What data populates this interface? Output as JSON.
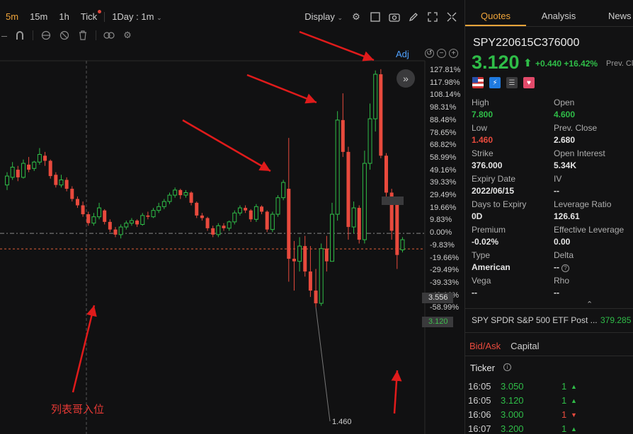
{
  "toolbar": {
    "intervals": [
      "5m",
      "15m",
      "1h",
      "Tick"
    ],
    "active_interval": "5m",
    "range_select": "1Day : 1m",
    "display_label": "Display"
  },
  "chart": {
    "adj_label": "Adj",
    "y_ticks": [
      "127.81%",
      "117.98%",
      "108.14%",
      "98.31%",
      "88.48%",
      "78.65%",
      "68.82%",
      "58.99%",
      "49.16%",
      "39.33%",
      "29.49%",
      "19.66%",
      "9.83%",
      "0.00%",
      "-9.83%",
      "-19.66%",
      "-29.49%",
      "-39.33%",
      "-49.16%",
      "-58.99%"
    ],
    "ref_price_tag": "3.556",
    "current_price_tag": "3.120",
    "low_label": "1.460",
    "annotation_text": "列表哥入位",
    "colors": {
      "up": "#2fbd48",
      "down": "#e84a3d",
      "arrow": "#e01b1b"
    }
  },
  "chart_data": {
    "type": "candlestick",
    "ylabel": "",
    "ylim": [
      -58.99,
      127.81
    ],
    "y_unit": "% change vs ref 3.556",
    "candles": [
      {
        "o": 38,
        "c": 45,
        "h": 48,
        "l": 34
      },
      {
        "o": 44,
        "c": 52,
        "h": 56,
        "l": 42
      },
      {
        "o": 50,
        "c": 44,
        "h": 53,
        "l": 41
      },
      {
        "o": 44,
        "c": 55,
        "h": 58,
        "l": 43
      },
      {
        "o": 54,
        "c": 50,
        "h": 60,
        "l": 48
      },
      {
        "o": 51,
        "c": 56,
        "h": 57,
        "l": 49
      },
      {
        "o": 56,
        "c": 62,
        "h": 67,
        "l": 54
      },
      {
        "o": 61,
        "c": 57,
        "h": 64,
        "l": 53
      },
      {
        "o": 57,
        "c": 45,
        "h": 58,
        "l": 43
      },
      {
        "o": 46,
        "c": 38,
        "h": 48,
        "l": 36
      },
      {
        "o": 38,
        "c": 42,
        "h": 46,
        "l": 36
      },
      {
        "o": 42,
        "c": 35,
        "h": 44,
        "l": 33
      },
      {
        "o": 35,
        "c": 27,
        "h": 37,
        "l": 25
      },
      {
        "o": 27,
        "c": 22,
        "h": 29,
        "l": 20
      },
      {
        "o": 22,
        "c": 15,
        "h": 25,
        "l": 13
      },
      {
        "o": 15,
        "c": 8,
        "h": 17,
        "l": 6
      },
      {
        "o": 8,
        "c": 13,
        "h": 16,
        "l": 6
      },
      {
        "o": 13,
        "c": 20,
        "h": 24,
        "l": 11
      },
      {
        "o": 18,
        "c": 9,
        "h": 19,
        "l": 7
      },
      {
        "o": 9,
        "c": 3,
        "h": 11,
        "l": 1
      },
      {
        "o": 3,
        "c": -1,
        "h": 5,
        "l": -3
      },
      {
        "o": -1,
        "c": 5,
        "h": 7,
        "l": -4
      },
      {
        "o": 5,
        "c": 8,
        "h": 10,
        "l": 3
      },
      {
        "o": 8,
        "c": 10,
        "h": 12,
        "l": 6
      },
      {
        "o": 10,
        "c": 7,
        "h": 11,
        "l": 5
      },
      {
        "o": 7,
        "c": 14,
        "h": 16,
        "l": 6
      },
      {
        "o": 14,
        "c": 13,
        "h": 17,
        "l": 11
      },
      {
        "o": 13,
        "c": 18,
        "h": 20,
        "l": 12
      },
      {
        "o": 18,
        "c": 21,
        "h": 24,
        "l": 16
      },
      {
        "o": 21,
        "c": 25,
        "h": 27,
        "l": 19
      },
      {
        "o": 25,
        "c": 30,
        "h": 32,
        "l": 23
      },
      {
        "o": 30,
        "c": 34,
        "h": 36,
        "l": 28
      },
      {
        "o": 34,
        "c": 30,
        "h": 35,
        "l": 27
      },
      {
        "o": 30,
        "c": 32,
        "h": 34,
        "l": 28
      },
      {
        "o": 32,
        "c": 24,
        "h": 33,
        "l": 22
      },
      {
        "o": 24,
        "c": 14,
        "h": 25,
        "l": 12
      },
      {
        "o": 14,
        "c": 12,
        "h": 16,
        "l": 10
      },
      {
        "o": 12,
        "c": 4,
        "h": 13,
        "l": 2
      },
      {
        "o": 4,
        "c": -1,
        "h": 6,
        "l": -3
      },
      {
        "o": -1,
        "c": 6,
        "h": 8,
        "l": -3
      },
      {
        "o": 6,
        "c": 4,
        "h": 8,
        "l": 2
      },
      {
        "o": 4,
        "c": 9,
        "h": 10,
        "l": 2
      },
      {
        "o": 9,
        "c": 16,
        "h": 18,
        "l": 7
      },
      {
        "o": 16,
        "c": 20,
        "h": 22,
        "l": 14
      },
      {
        "o": 20,
        "c": 18,
        "h": 22,
        "l": 16
      },
      {
        "o": 18,
        "c": 11,
        "h": 19,
        "l": 9
      },
      {
        "o": 11,
        "c": 21,
        "h": 23,
        "l": 9
      },
      {
        "o": 21,
        "c": 17,
        "h": 22,
        "l": 15
      },
      {
        "o": 17,
        "c": 3,
        "h": 18,
        "l": 1
      },
      {
        "o": 3,
        "c": 15,
        "h": 17,
        "l": 1
      },
      {
        "o": 15,
        "c": 28,
        "h": 30,
        "l": 13
      },
      {
        "o": 28,
        "c": 40,
        "h": 42,
        "l": 26
      },
      {
        "o": 35,
        "c": -20,
        "h": 75,
        "l": -38
      },
      {
        "o": -20,
        "c": -22,
        "h": -6,
        "l": -45
      },
      {
        "o": -22,
        "c": -10,
        "h": -3,
        "l": -30
      },
      {
        "o": -10,
        "c": -30,
        "h": -2,
        "l": -34
      },
      {
        "o": -30,
        "c": -45,
        "h": -10,
        "l": -50
      },
      {
        "o": -45,
        "c": -55,
        "h": -28,
        "l": -58
      },
      {
        "o": -55,
        "c": -12,
        "h": -8,
        "l": -57
      },
      {
        "o": -12,
        "c": -22,
        "h": -2,
        "l": -30
      },
      {
        "o": -22,
        "c": 15,
        "h": 24,
        "l": -22
      },
      {
        "o": 15,
        "c": 89,
        "h": 96,
        "l": 10
      },
      {
        "o": 89,
        "c": 64,
        "h": 110,
        "l": 60
      },
      {
        "o": 64,
        "c": 5,
        "h": 68,
        "l": -5
      },
      {
        "o": 5,
        "c": 20,
        "h": 25,
        "l": 0
      },
      {
        "o": 20,
        "c": -5,
        "h": 22,
        "l": -8
      },
      {
        "o": -5,
        "c": 55,
        "h": 65,
        "l": -8
      },
      {
        "o": 55,
        "c": 90,
        "h": 102,
        "l": 50
      },
      {
        "o": 90,
        "c": 125,
        "h": 128,
        "l": 80
      },
      {
        "o": 125,
        "c": 61,
        "h": 129,
        "l": 59
      },
      {
        "o": 61,
        "c": 32,
        "h": 63,
        "l": 28
      },
      {
        "o": 32,
        "c": 2,
        "h": 35,
        "l": -5
      },
      {
        "o": 25,
        "c": -17,
        "h": 28,
        "l": -28
      },
      {
        "o": -13,
        "c": -5,
        "h": -3,
        "l": -15
      }
    ]
  },
  "quote": {
    "tabs": [
      "Quotes",
      "Analysis",
      "News"
    ],
    "symbol": "SPY220615C376000",
    "price": "3.120",
    "change": "+0.440",
    "change_pct": "+16.42%",
    "prev_truncated": "Prev. Cl",
    "fields": [
      {
        "label": "High",
        "value": "7.800",
        "color": "green"
      },
      {
        "label": "Open",
        "value": "4.600",
        "color": "green"
      },
      {
        "label": "Low",
        "value": "1.460",
        "color": "red"
      },
      {
        "label": "Prev. Close",
        "value": "2.680",
        "color": "white"
      },
      {
        "label": "Strike",
        "value": "376.000",
        "color": "white"
      },
      {
        "label": "Open Interest",
        "value": "5.34K",
        "color": "white"
      },
      {
        "label": "Expiry Date",
        "value": "2022/06/15",
        "color": "white"
      },
      {
        "label": "IV",
        "value": "--",
        "color": "white"
      },
      {
        "label": "Days to Expiry",
        "value": "0D",
        "color": "white"
      },
      {
        "label": "Leverage Ratio",
        "value": "126.61",
        "color": "white"
      },
      {
        "label": "Premium",
        "value": "-0.02%",
        "color": "white"
      },
      {
        "label": "Effective Leverage",
        "value": "0.00",
        "color": "white"
      },
      {
        "label": "Type",
        "value": "American",
        "color": "white"
      },
      {
        "label": "Delta",
        "value": "--",
        "color": "white"
      },
      {
        "label": "Vega",
        "value": "--",
        "color": "white"
      },
      {
        "label": "Rho",
        "value": "--",
        "color": "white"
      }
    ],
    "underlying_label": "SPY SPDR S&P 500 ETF Post ...",
    "underlying_value": "379.285",
    "sub_tabs": [
      "Bid/Ask",
      "Capital"
    ],
    "ticker_title": "Ticker",
    "ticks": [
      {
        "time": "16:05",
        "price": "3.050",
        "qty": "1",
        "dir": "up"
      },
      {
        "time": "16:05",
        "price": "3.120",
        "qty": "1",
        "dir": "up"
      },
      {
        "time": "16:06",
        "price": "3.000",
        "qty": "1",
        "dir": "down"
      },
      {
        "time": "16:07",
        "price": "3.200",
        "qty": "1",
        "dir": "up"
      }
    ]
  }
}
